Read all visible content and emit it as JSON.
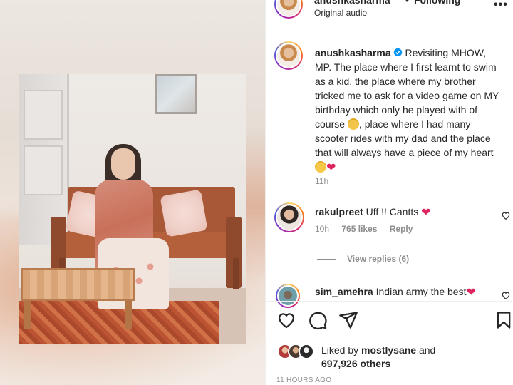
{
  "header": {
    "username": "anushkasharma",
    "dot": "•",
    "follow_state": "Following",
    "audio": "Original audio",
    "more": "•••"
  },
  "caption": {
    "username": "anushkasharma",
    "text": "Revisiting MHOW, MP. The place where I first learnt to swim as a kid, the place where my brother tricked me to ask for a video game on MY birthday which only he played with of course",
    "text_2": ", place where I had many scooter rides with my dad and the place that will always have a piece of my heart",
    "time": "11h"
  },
  "comments": [
    {
      "username": "rakulpreet",
      "text": "Uff !! Cantts",
      "time": "10h",
      "likes": "765 likes",
      "reply": "Reply"
    },
    {
      "username": "sim_amehra",
      "text": "Indian army the best"
    }
  ],
  "replies": {
    "label": "View replies (6)"
  },
  "likes": {
    "prefix": "Liked by",
    "by": "mostlysane",
    "and": "and",
    "count": "697,926 others"
  },
  "timestamp": "11 HOURS AGO",
  "icons": {
    "verified": "verified-badge-icon",
    "like": "heart-outline-icon",
    "comment": "comment-bubble-icon",
    "share": "paper-plane-icon",
    "save": "bookmark-icon",
    "more": "more-options-icon"
  },
  "colors": {
    "verified": "#0095f6",
    "heart": "#ed4956",
    "meta": "#8e8e8e"
  }
}
